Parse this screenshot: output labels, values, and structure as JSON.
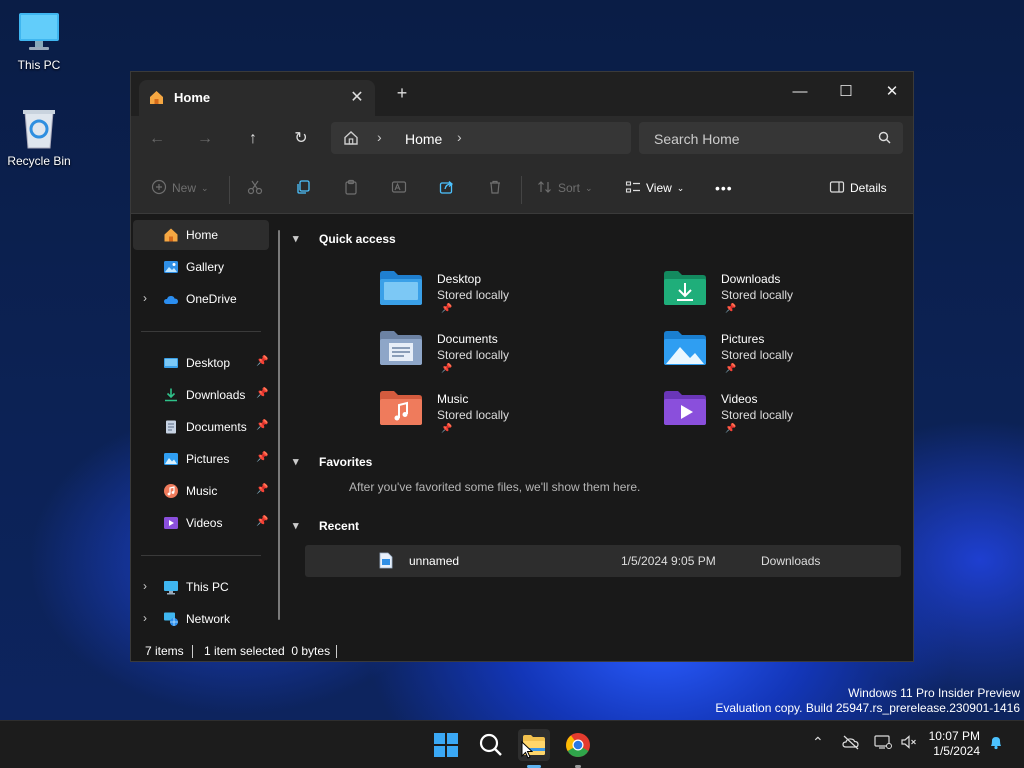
{
  "desktop": {
    "icons": [
      {
        "label": "This PC",
        "icon": "monitor-icon"
      },
      {
        "label": "Recycle Bin",
        "icon": "recycle-bin-icon"
      }
    ],
    "watermark_line1": "Windows 11 Pro Insider Preview",
    "watermark_line2": "Evaluation copy. Build 25947.rs_prerelease.230901-1416"
  },
  "window": {
    "tab_title": "Home",
    "tab_close": "✕",
    "new_tab": "+",
    "controls": {
      "minimize": "—",
      "maximize": "☐",
      "close": "✕"
    },
    "address": {
      "location": "Home"
    },
    "search_placeholder": "Search Home",
    "toolbar": {
      "new": "New",
      "sort": "Sort",
      "view": "View",
      "more": "•••",
      "details": "Details"
    },
    "sidebar": {
      "items": [
        {
          "label": "Home",
          "icon": "home-icon",
          "selected": true
        },
        {
          "label": "Gallery",
          "icon": "gallery-icon"
        },
        {
          "label": "OneDrive",
          "icon": "cloud-icon"
        },
        {
          "label": "Desktop",
          "icon": "desktop-folder-icon"
        },
        {
          "label": "Downloads",
          "icon": "download-icon"
        },
        {
          "label": "Documents",
          "icon": "document-icon"
        },
        {
          "label": "Pictures",
          "icon": "pictures-icon"
        },
        {
          "label": "Music",
          "icon": "music-icon"
        },
        {
          "label": "Videos",
          "icon": "videos-icon"
        },
        {
          "label": "This PC",
          "icon": "monitor-icon"
        },
        {
          "label": "Network",
          "icon": "network-icon"
        }
      ]
    },
    "main": {
      "quick_access_title": "Quick access",
      "quick_access": [
        {
          "name": "Desktop",
          "sub": "Stored locally",
          "color": "#3aa0e8"
        },
        {
          "name": "Downloads",
          "sub": "Stored locally",
          "color": "#1fae7a"
        },
        {
          "name": "Documents",
          "sub": "Stored locally",
          "color": "#8ea6c8"
        },
        {
          "name": "Pictures",
          "sub": "Stored locally",
          "color": "#2f9ef2"
        },
        {
          "name": "Music",
          "sub": "Stored locally",
          "color": "#ef7b5c"
        },
        {
          "name": "Videos",
          "sub": "Stored locally",
          "color": "#8a4fdc"
        }
      ],
      "favorites_title": "Favorites",
      "favorites_empty": "After you've favorited some files, we'll show them here.",
      "recent_title": "Recent",
      "recent": [
        {
          "name": "unnamed",
          "date": "1/5/2024 9:05 PM",
          "location": "Downloads"
        }
      ]
    },
    "status": {
      "items": "7 items",
      "selection": "1 item selected  0 bytes"
    }
  },
  "taskbar": {
    "time": "10:07 PM",
    "date": "1/5/2024"
  }
}
